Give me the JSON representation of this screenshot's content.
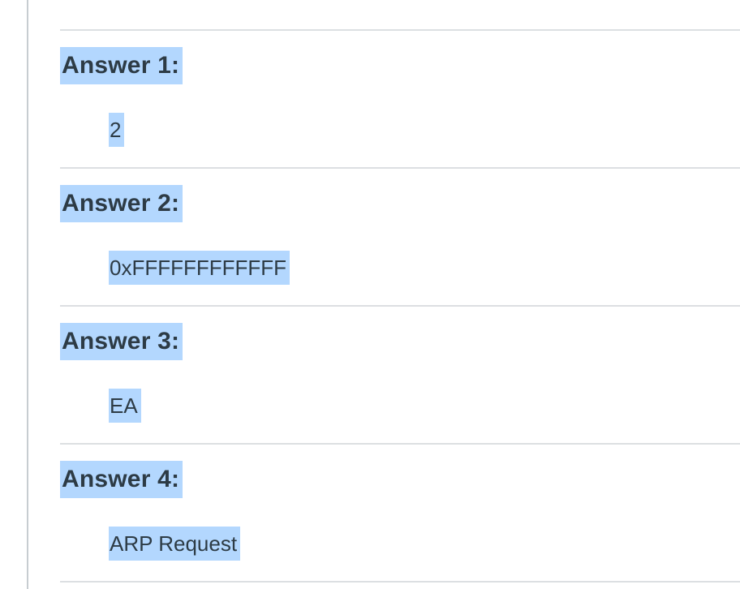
{
  "answers": [
    {
      "heading": "Answer 1:",
      "value": "2"
    },
    {
      "heading": "Answer 2:",
      "value": "0xFFFFFFFFFFFF"
    },
    {
      "heading": "Answer 3:",
      "value": "EA"
    },
    {
      "heading": "Answer 4:",
      "value": "ARP Request"
    }
  ],
  "colors": {
    "selection_highlight": "#b3d7fe",
    "divider": "#dcdfe2",
    "text": "#2d3b45"
  }
}
